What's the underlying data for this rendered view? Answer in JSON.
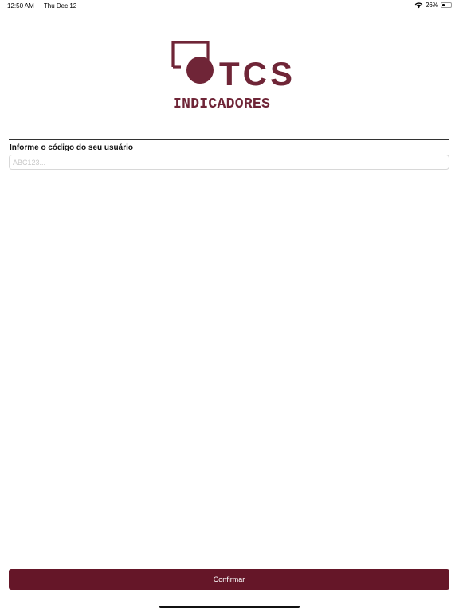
{
  "status_bar": {
    "time": "12:50 AM",
    "date": "Thu Dec 12",
    "battery_percent_label": "26%",
    "battery_level": 0.26,
    "icons": [
      "wifi-icon",
      "battery-icon"
    ]
  },
  "logo": {
    "name": "TCS",
    "subtitle": "INDICADORES",
    "color": "#6f2537"
  },
  "form": {
    "label": "Informe o código do seu usuário",
    "input_value": "",
    "input_placeholder": "ABC123..."
  },
  "confirm_button": {
    "label": "Confirmar",
    "color": "#651628"
  }
}
